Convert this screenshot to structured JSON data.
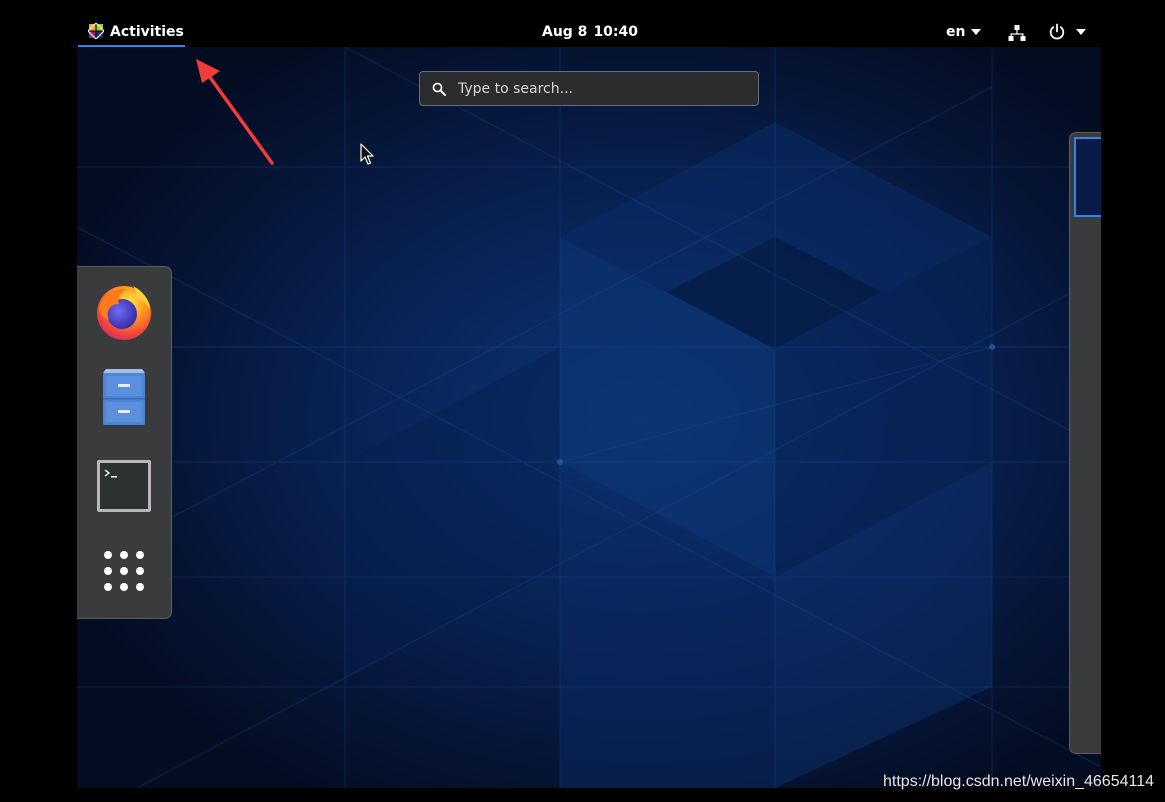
{
  "topbar": {
    "activities_label": "Activities",
    "clock": {
      "date": "Aug 8",
      "time": "10:40"
    },
    "input_source": "en",
    "network_icon": "network-wired-icon",
    "power_icon": "power-icon"
  },
  "search": {
    "placeholder": "Type to search..."
  },
  "dash": {
    "items": [
      {
        "name": "Firefox",
        "icon": "firefox-icon"
      },
      {
        "name": "Files",
        "icon": "file-cabinet-icon"
      },
      {
        "name": "Terminal",
        "icon": "terminal-icon"
      },
      {
        "name": "Show Applications",
        "icon": "app-grid-icon"
      }
    ]
  },
  "colors": {
    "accent": "#3584e4",
    "panel": "#393b3d",
    "background": "#06112b",
    "annotation": "#f03c3c"
  },
  "watermark": "https://blog.csdn.net/weixin_46654114"
}
